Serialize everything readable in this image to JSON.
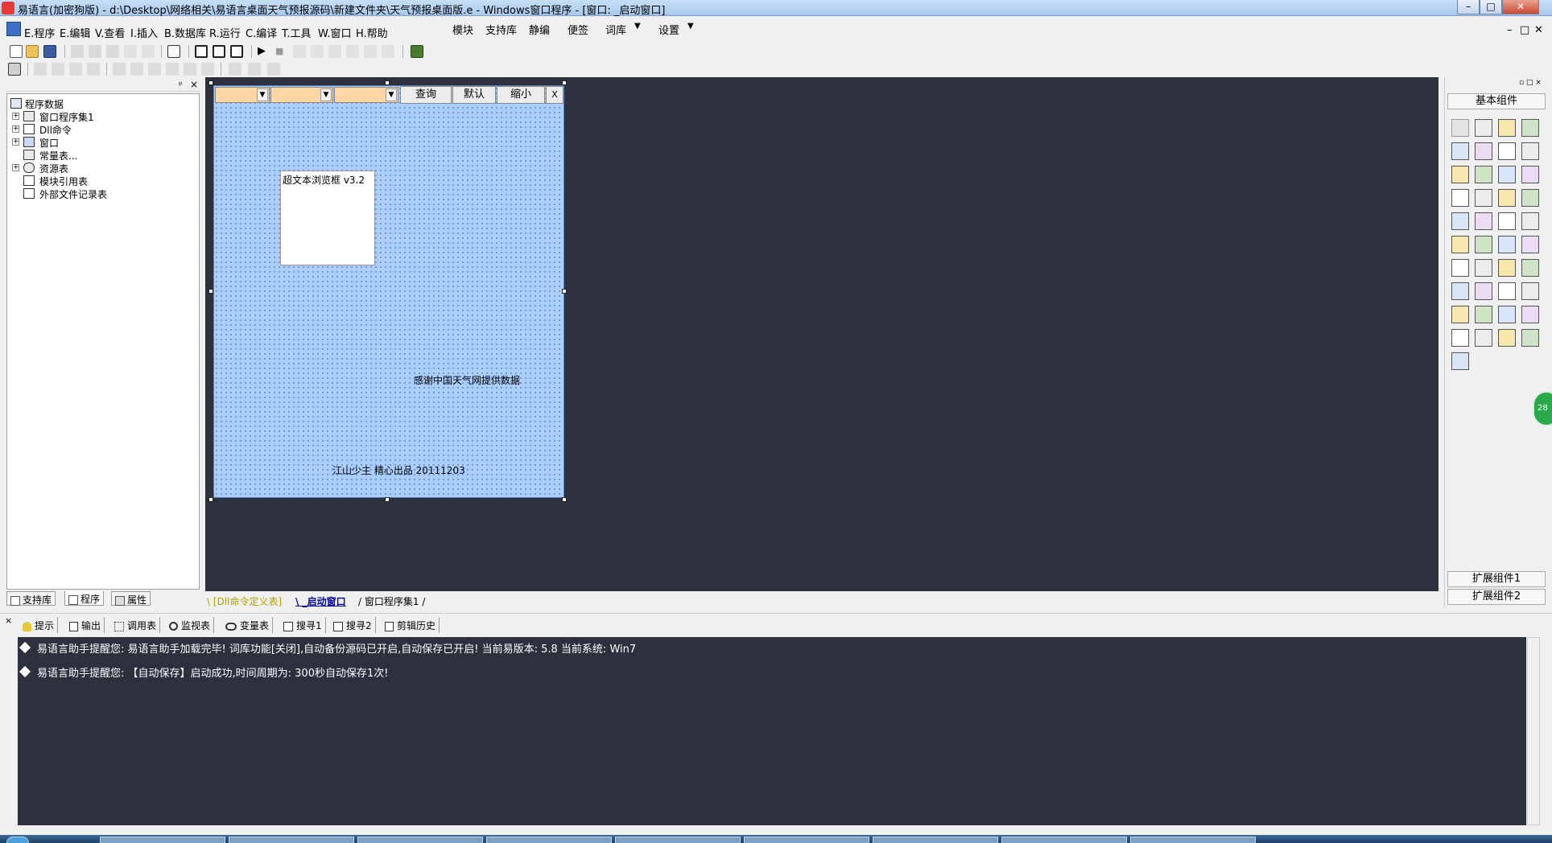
{
  "titlebar": {
    "title": "易语言(加密狗版) - d:\\Desktop\\网络相关\\易语言桌面天气预报源码\\新建文件夹\\天气预报桌面版.e - Windows窗口程序 - [窗口: _启动窗口]",
    "min": "–",
    "max": "□",
    "close": "✕"
  },
  "menubar": {
    "items": [
      "E.程序",
      "E.编辑",
      "V.查看",
      "I.插入",
      "B.数据库",
      "R.运行",
      "C.编译",
      "T.工具",
      "W.窗口",
      "H.帮助"
    ],
    "extra": [
      "模块",
      "支持库",
      "静编",
      "便签",
      "词库",
      "设置"
    ],
    "mdi_min": "–",
    "mdi_restore": "□",
    "mdi_close": "✕"
  },
  "left_panel": {
    "tree": [
      {
        "label": "程序数据",
        "expander": ""
      },
      {
        "label": "窗口程序集1",
        "expander": "+"
      },
      {
        "label": "Dll命令",
        "expander": "+"
      },
      {
        "label": "窗口",
        "expander": "+"
      },
      {
        "label": "常量表...",
        "expander": ""
      },
      {
        "label": "资源表",
        "expander": "+"
      },
      {
        "label": "模块引用表",
        "expander": ""
      },
      {
        "label": "外部文件记录表",
        "expander": ""
      }
    ],
    "tabs": [
      "支持库",
      "程序",
      "属性"
    ],
    "pin": "ᵖ",
    "close": "×"
  },
  "form": {
    "buttons": [
      "查询",
      "默认",
      "缩小",
      "X"
    ],
    "browser_label": "超文本浏览框 v3.2",
    "thanks_label": "感谢中国天气网提供数据",
    "credit_label": "江山少主 精心出品 20111203"
  },
  "designer_tabs": [
    "[Dll命令定义表]",
    "_启动窗口",
    "窗口程序集1"
  ],
  "right_panel": {
    "title": "基本组件",
    "ext1": "扩展组件1",
    "ext2": "扩展组件2",
    "controls": "▫ □ ×"
  },
  "bottom_tabs": [
    "提示",
    "输出",
    "调用表",
    "监视表",
    "变量表",
    "搜寻1",
    "搜寻2",
    "剪辑历史"
  ],
  "output": {
    "lines": [
      "易语言助手提醒您:  易语言助手加载完毕! 词库功能[关闭],自动备份源码已开启,自动保存已开启! 当前易版本: 5.8  当前系统: Win7",
      "易语言助手提醒您: 【自动保存】启动成功,时间周期为: 300秒自动保存1次!"
    ]
  },
  "badge": "28",
  "colors": {
    "form_bg": "#a9ceff",
    "dark_bg": "#2c313d",
    "combo_bg": "#fad7a4"
  }
}
